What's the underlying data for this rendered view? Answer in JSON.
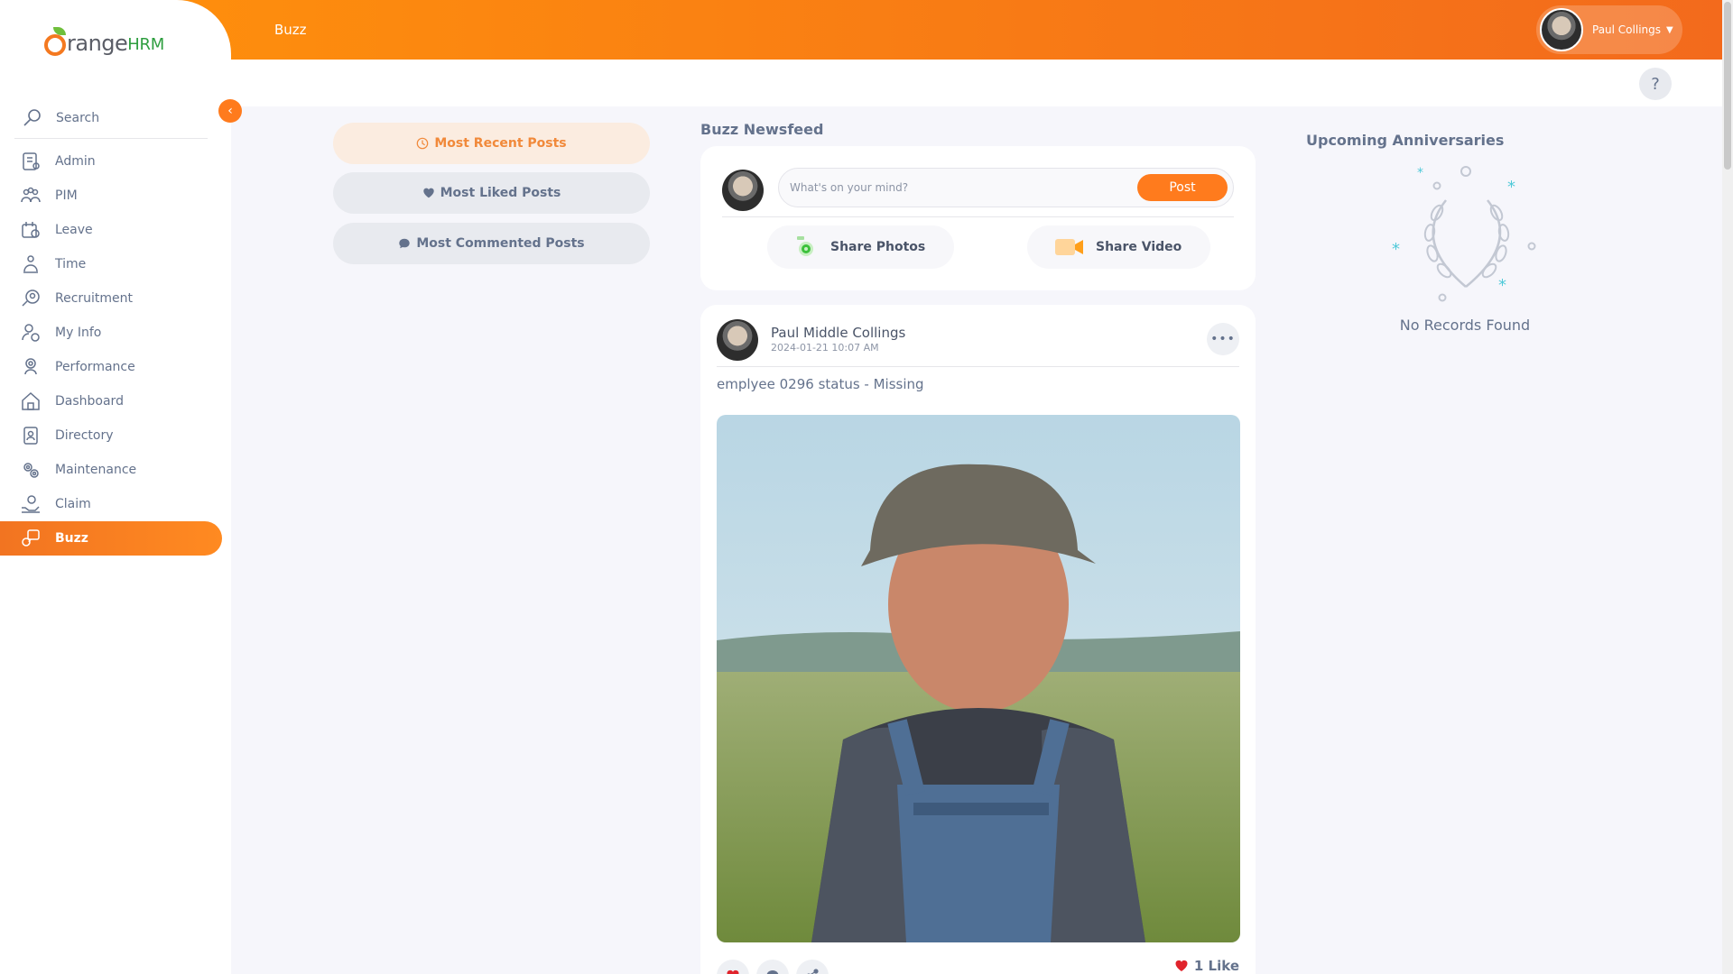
{
  "app": {
    "brand_text": "range",
    "brand_hrm": "HRM"
  },
  "header": {
    "title": "Buzz",
    "user_name": "Paul Collings",
    "help_label": "?"
  },
  "sidebar": {
    "search_label": "Search",
    "items": [
      {
        "label": "Admin",
        "icon": "admin-icon"
      },
      {
        "label": "PIM",
        "icon": "pim-icon"
      },
      {
        "label": "Leave",
        "icon": "leave-icon"
      },
      {
        "label": "Time",
        "icon": "time-icon"
      },
      {
        "label": "Recruitment",
        "icon": "recruitment-icon"
      },
      {
        "label": "My Info",
        "icon": "my-info-icon"
      },
      {
        "label": "Performance",
        "icon": "performance-icon"
      },
      {
        "label": "Dashboard",
        "icon": "dashboard-icon"
      },
      {
        "label": "Directory",
        "icon": "directory-icon"
      },
      {
        "label": "Maintenance",
        "icon": "maintenance-icon"
      },
      {
        "label": "Claim",
        "icon": "claim-icon"
      },
      {
        "label": "Buzz",
        "icon": "buzz-icon",
        "active": true
      }
    ]
  },
  "filters": {
    "most_recent": "Most Recent Posts",
    "most_liked": "Most Liked Posts",
    "most_commented": "Most Commented Posts"
  },
  "feed": {
    "title": "Buzz Newsfeed",
    "composer": {
      "placeholder": "What's on your mind?",
      "post_label": "Post",
      "share_photos": "Share Photos",
      "share_video": "Share Video"
    },
    "post": {
      "author": "Paul Middle Collings",
      "timestamp": "2024-01-21 10:07 AM",
      "text": "emplyee 0296  status - Missing",
      "like_count": "1 Like"
    }
  },
  "anniversaries": {
    "title": "Upcoming Anniversaries",
    "empty_text": "No Records Found"
  },
  "colors": {
    "accent": "#ff7b1d",
    "header_start": "#ff920b",
    "header_end": "#f36a1c",
    "text": "#64728c",
    "background": "#f6f6fb"
  }
}
